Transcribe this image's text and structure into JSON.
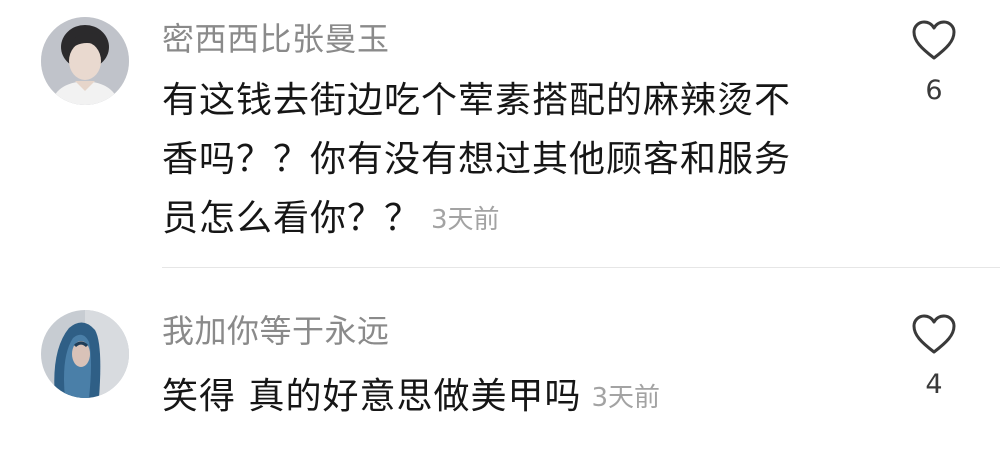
{
  "comments": [
    {
      "username": "密西西比张曼玉",
      "lines": [
        "有这钱去街边吃个荤素搭配的麻辣烫不",
        "香吗？？你有没有想过其他顾客和服务",
        "员怎么看你？？"
      ],
      "time": "3天前",
      "likes": "6",
      "avatar_icon": "avatar-male-portrait"
    },
    {
      "username": "我加你等于永远",
      "lines": [
        "笑得 真的好意思做美甲吗"
      ],
      "time": "3天前",
      "likes": "4",
      "avatar_icon": "avatar-blue-hair-portrait"
    }
  ],
  "colors": {
    "username": "#8a8a8a",
    "text": "#161616",
    "time": "#a3a3a3",
    "heart_outline": "#3a3a3a"
  }
}
